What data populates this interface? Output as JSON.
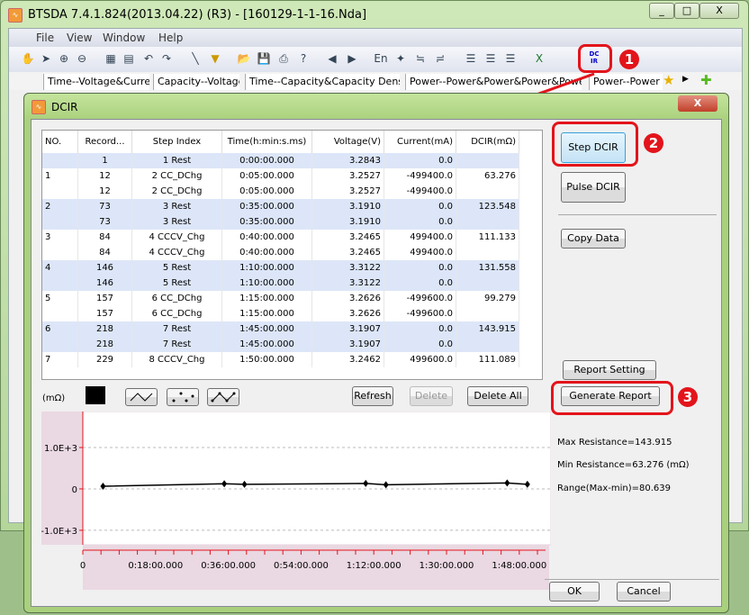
{
  "app": {
    "title": "BTSDA 7.4.1.824(2013.04.22) (R3) - [160129-1-1-16.Nda]",
    "icon": "app-icon"
  },
  "window_controls": [
    "_",
    "□",
    "X"
  ],
  "menu": [
    "File",
    "View",
    "Window",
    "Help"
  ],
  "toolbar": {
    "icons": [
      "hand-icon",
      "pointer-icon",
      "zoom-in-icon",
      "zoom-out-icon",
      "rst-icon",
      "copy-icon",
      "undo-icon",
      "redo-icon",
      "line-icon",
      "filter-icon",
      "open-icon",
      "save-icon",
      "print-icon",
      "help-icon",
      "back-icon",
      "forward-icon",
      "en-icon",
      "pin-icon",
      "ch1-icon",
      "ch2-icon",
      "list1-icon",
      "list2-icon",
      "list3-icon",
      "excel-icon"
    ],
    "dcir_label": "DC\nIR"
  },
  "tabs": [
    "Time--Voltage&Current",
    "Capacity--Voltage",
    "Time--Capacity&Capacity Density",
    "Power--Power&Power&Power&Power",
    "Power--Power"
  ],
  "annotations": {
    "badge1": "1",
    "badge2": "2",
    "badge3": "3",
    "accent": "#e3141b"
  },
  "dialog": {
    "title": "DCIR",
    "close": "X",
    "table": {
      "headers": [
        "NO.",
        "Record...",
        "Step Index",
        "Time(h:min:s.ms)",
        "Voltage(V)",
        "Current(mA)",
        "DCIR(mΩ)"
      ],
      "rows": [
        [
          "",
          "1",
          "1 Rest",
          "0:00:00.000",
          "3.2843",
          "0.0",
          ""
        ],
        [
          "1",
          "12",
          "2 CC_DChg",
          "0:05:00.000",
          "3.2527",
          "-499400.0",
          "63.276"
        ],
        [
          "",
          "12",
          "2 CC_DChg",
          "0:05:00.000",
          "3.2527",
          "-499400.0",
          ""
        ],
        [
          "2",
          "73",
          "3 Rest",
          "0:35:00.000",
          "3.1910",
          "0.0",
          "123.548"
        ],
        [
          "",
          "73",
          "3 Rest",
          "0:35:00.000",
          "3.1910",
          "0.0",
          ""
        ],
        [
          "3",
          "84",
          "4 CCCV_Chg",
          "0:40:00.000",
          "3.2465",
          "499400.0",
          "111.133"
        ],
        [
          "",
          "84",
          "4 CCCV_Chg",
          "0:40:00.000",
          "3.2465",
          "499400.0",
          ""
        ],
        [
          "4",
          "146",
          "5 Rest",
          "1:10:00.000",
          "3.3122",
          "0.0",
          "131.558"
        ],
        [
          "",
          "146",
          "5 Rest",
          "1:10:00.000",
          "3.3122",
          "0.0",
          ""
        ],
        [
          "5",
          "157",
          "6 CC_DChg",
          "1:15:00.000",
          "3.2626",
          "-499600.0",
          "99.279"
        ],
        [
          "",
          "157",
          "6 CC_DChg",
          "1:15:00.000",
          "3.2626",
          "-499600.0",
          ""
        ],
        [
          "6",
          "218",
          "7 Rest",
          "1:45:00.000",
          "3.1907",
          "0.0",
          "143.915"
        ],
        [
          "",
          "218",
          "7 Rest",
          "1:45:00.000",
          "3.1907",
          "0.0",
          ""
        ],
        [
          "7",
          "229",
          "8 CCCV_Chg",
          "1:50:00.000",
          "3.2462",
          "499600.0",
          "111.089"
        ]
      ]
    },
    "buttons": {
      "step_dcir": "Step DCIR",
      "pulse_dcir": "Pulse DCIR",
      "copy_data": "Copy Data",
      "report_setting": "Report Setting",
      "generate_report": "Generate Report",
      "refresh": "Refresh",
      "delete": "Delete",
      "delete_all": "Delete All",
      "ok": "OK",
      "cancel": "Cancel"
    },
    "chart_tools": [
      "color-swatch",
      "line-style-icon",
      "points-style-icon",
      "line-points-style-icon"
    ],
    "stats": {
      "max": "Max Resistance=143.915",
      "min": "Min Resistance=63.276  (mΩ)",
      "range": "Range(Max-min)=80.639"
    }
  },
  "chart_data": {
    "type": "line",
    "ylabel": "(mΩ)",
    "x_minutes": [
      5,
      35,
      40,
      70,
      75,
      105,
      110
    ],
    "x_labels": [
      "0:05:00.000",
      "0:35:00.000",
      "0:40:00.000",
      "1:10:00.000",
      "1:15:00.000",
      "1:45:00.000",
      "1:50:00.000"
    ],
    "values": [
      63.276,
      123.548,
      111.133,
      131.558,
      99.279,
      143.915,
      111.089
    ],
    "xlim": [
      0,
      114.5
    ],
    "ylim": [
      -1350,
      1870
    ],
    "yticks": [
      {
        "v": 1000,
        "label": "1.0E+3"
      },
      {
        "v": 0,
        "label": "0"
      },
      {
        "v": -1000,
        "label": "-1.0E+3"
      }
    ],
    "xticks": [
      {
        "v": 0,
        "label": "0"
      },
      {
        "v": 18,
        "label": "0:18:00.000"
      },
      {
        "v": 36,
        "label": "0:36:00.000"
      },
      {
        "v": 54,
        "label": "0:54:00.000"
      },
      {
        "v": 72,
        "label": "1:12:00.000"
      },
      {
        "v": 90,
        "label": "1:30:00.000"
      },
      {
        "v": 108,
        "label": "1:48:00.000"
      }
    ],
    "grid": "horizontal-dashed",
    "line_color": "#000000",
    "axis_color": "#e3141b"
  }
}
